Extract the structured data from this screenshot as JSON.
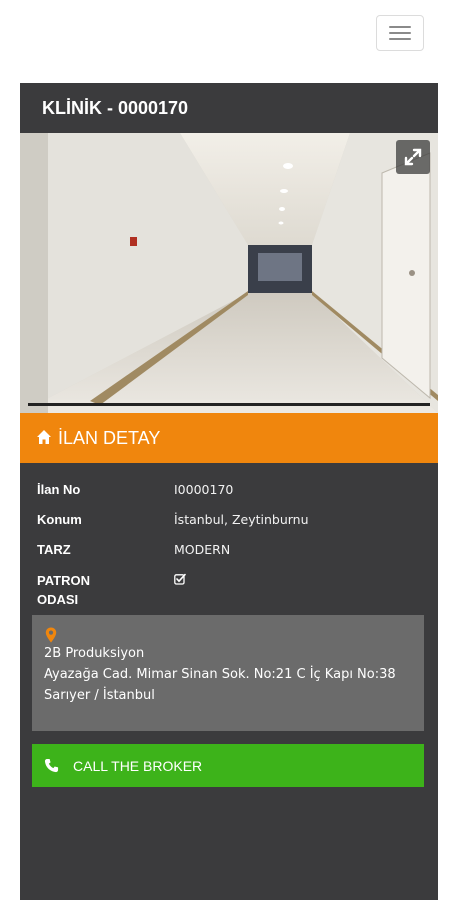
{
  "listing": {
    "title": "KLİNİK - 0000170",
    "photo_alt": "",
    "section_title": "İLAN DETAY"
  },
  "details": [
    {
      "label": "İlan No",
      "value": "I0000170"
    },
    {
      "label": "Konum",
      "value": "İstanbul, Zeytinburnu"
    },
    {
      "label": "TARZ",
      "value": "MODERN"
    },
    {
      "label": "PATRON ODASI",
      "value": "checked"
    }
  ],
  "address": {
    "company": "2B Produksiyon",
    "line": "Ayazağa Cad. Mimar Sinan Sok. No:21 C İç Kapı No:38 Sarıyer / İstanbul"
  },
  "actions": {
    "call_label": "CALL THE BROKER"
  },
  "colors": {
    "header_bg": "#3b3b3d",
    "section_accent": "#f0860d",
    "call_button": "#3db31a",
    "address_bg": "#6b6b6b"
  },
  "icons": [
    "menu-icon",
    "expand-icon",
    "home-icon",
    "checkbox-icon",
    "map-pin-icon",
    "phone-icon"
  ]
}
